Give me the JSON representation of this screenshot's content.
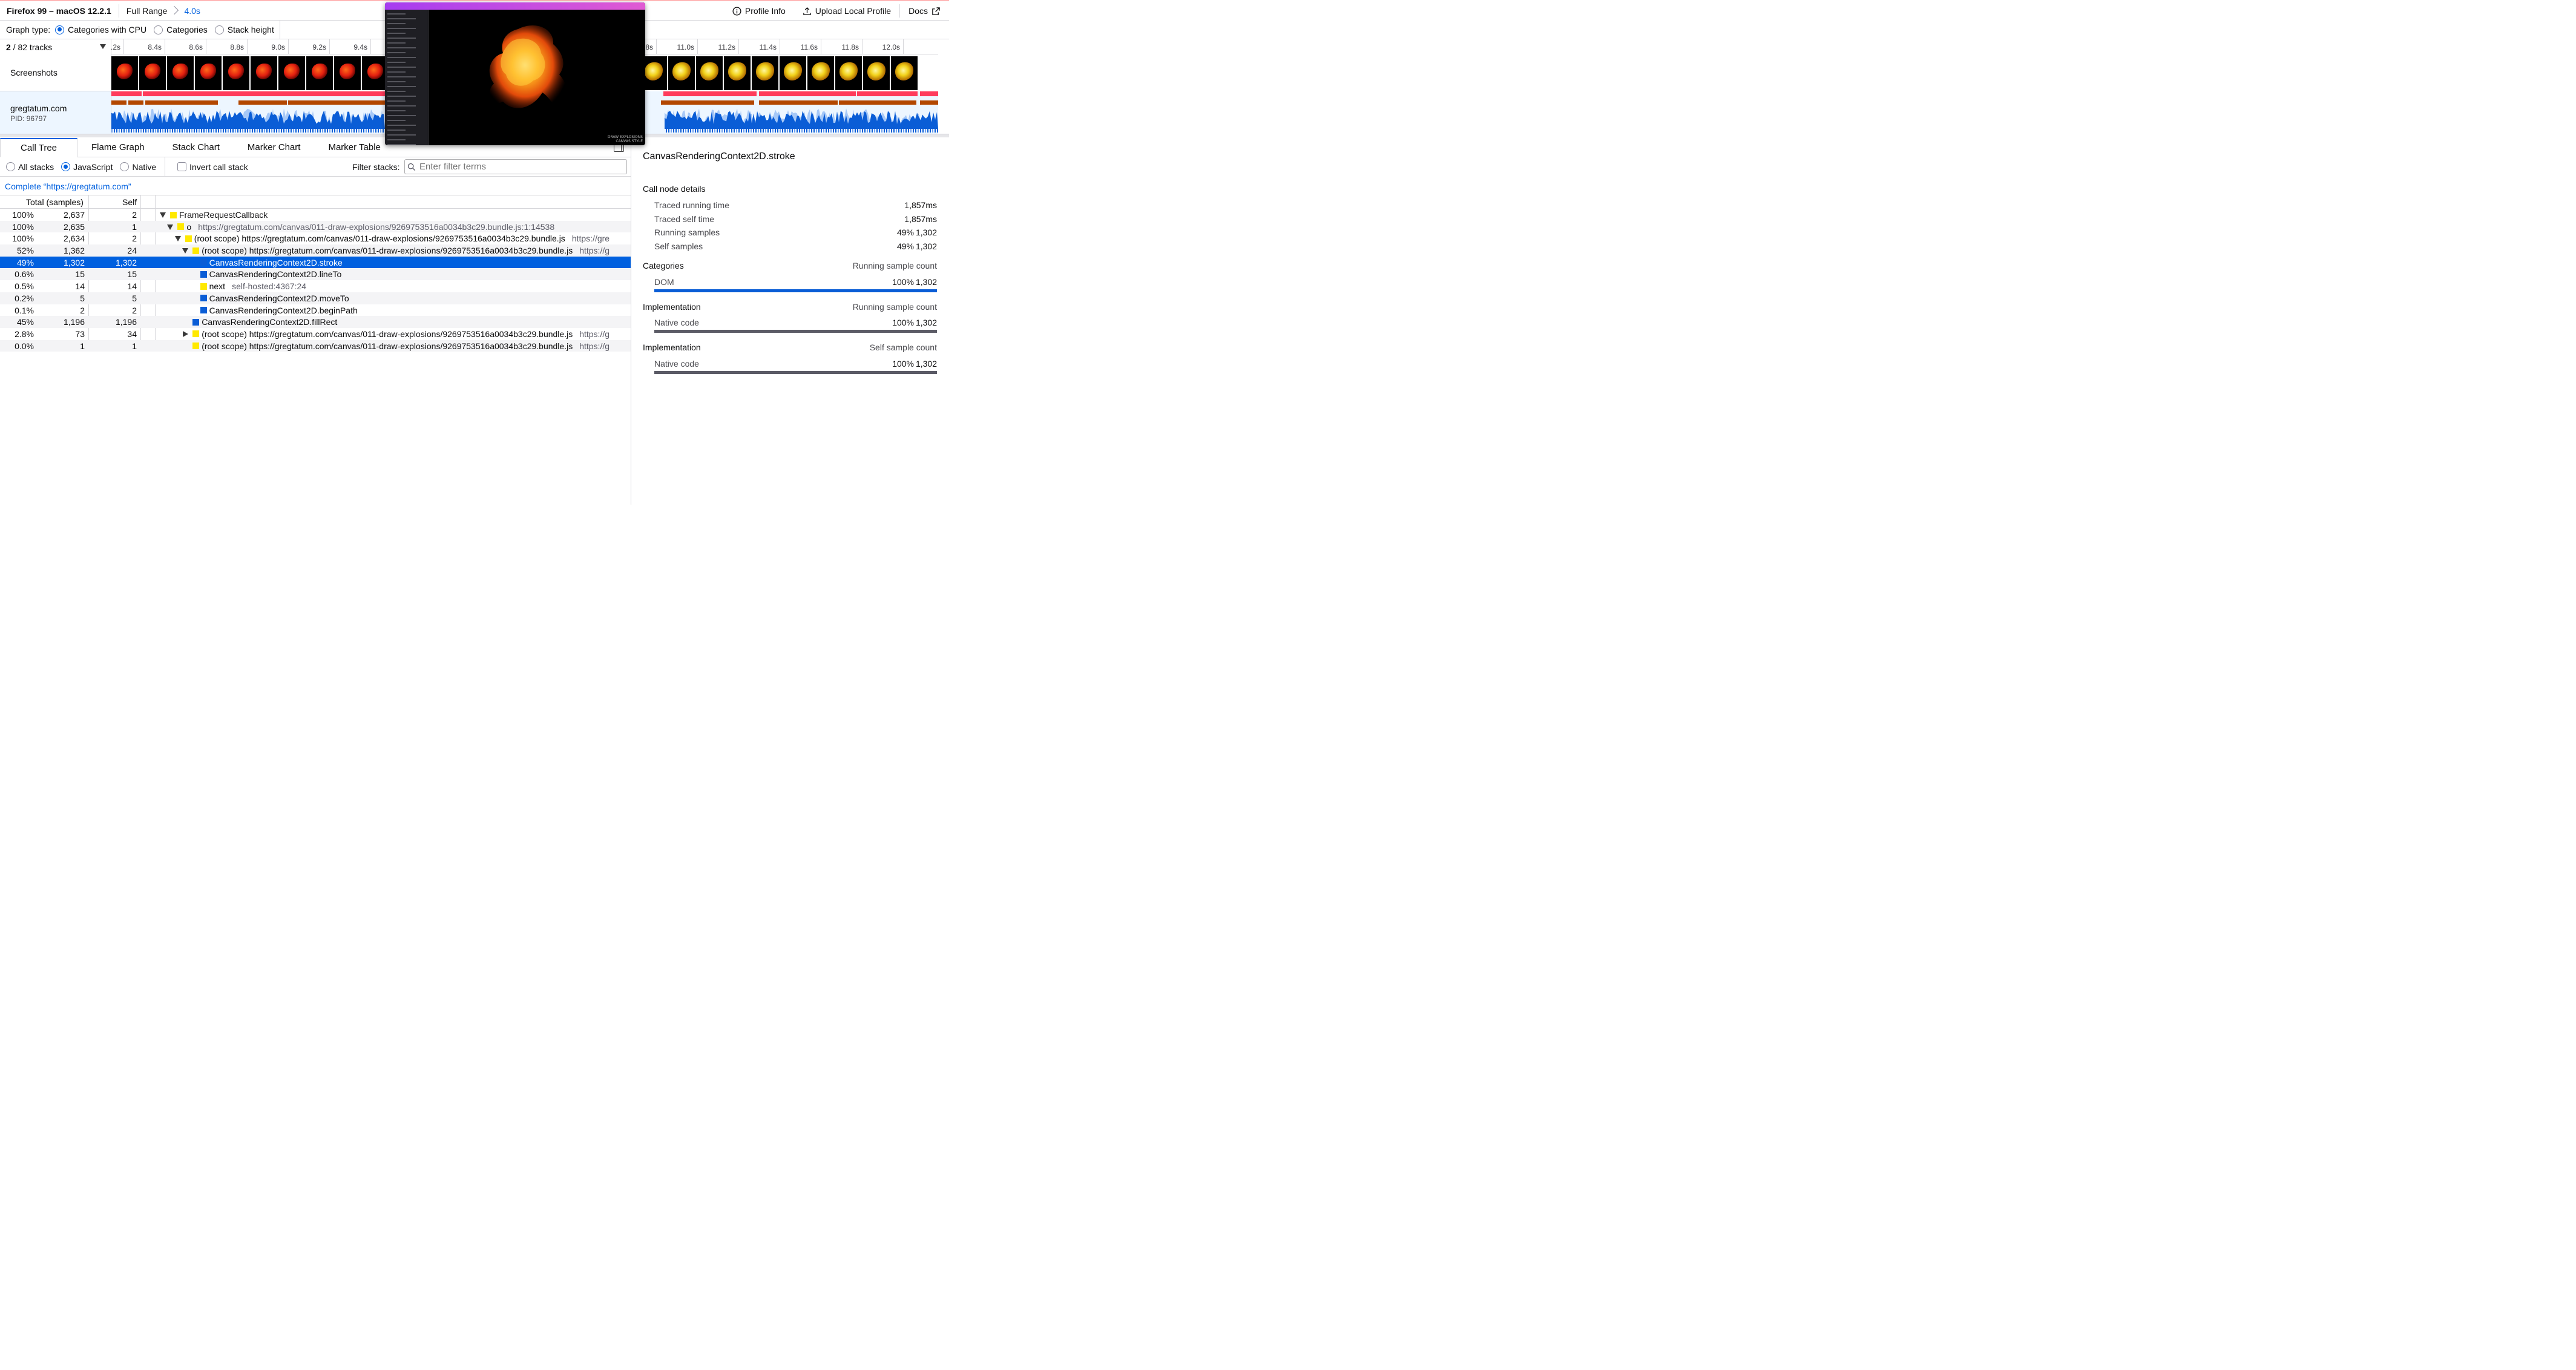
{
  "topbar": {
    "title": "Firefox 99 – macOS 12.2.1",
    "breadcrumb_root": "Full Range",
    "breadcrumb_selection": "4.0s",
    "profile_info": "Profile Info",
    "upload": "Upload Local Profile",
    "docs": "Docs"
  },
  "graph_type": {
    "label": "Graph type:",
    "options": [
      "Categories with CPU",
      "Categories",
      "Stack height"
    ],
    "selected": "Categories with CPU"
  },
  "tracks": {
    "count_current": "2",
    "count_text": " / 82 tracks",
    "ruler_labels": [
      ".2s",
      "8.4s",
      "8.6s",
      "8.8s",
      "9.0s",
      "9.2s",
      "9.4s",
      ".8s",
      "11.0s",
      "11.2s",
      "11.4s",
      "11.6s",
      "11.8s",
      "12.0s"
    ],
    "screenshots_label": "Screenshots",
    "process_name": "gregtatum.com",
    "process_pid": "PID: 96797"
  },
  "popup": {
    "caption_line1": "DRAW EXPLOSIONS",
    "caption_line2": "CANVAS STYLE"
  },
  "tabs": [
    "Call Tree",
    "Flame Graph",
    "Stack Chart",
    "Marker Chart",
    "Marker Table"
  ],
  "filter": {
    "all_stacks": "All stacks",
    "javascript": "JavaScript",
    "native": "Native",
    "invert": "Invert call stack",
    "filter_label": "Filter stacks:",
    "placeholder": "Enter filter terms"
  },
  "breadcrumb": "Complete “https://gregtatum.com”",
  "table": {
    "header_total": "Total (samples)",
    "header_self": "Self",
    "rows": [
      {
        "pct": "100%",
        "total": "2,637",
        "self": "2",
        "depth": 0,
        "twisty": "down",
        "cat": "js",
        "name": "FrameRequestCallback",
        "origin": ""
      },
      {
        "pct": "100%",
        "total": "2,635",
        "self": "1",
        "depth": 1,
        "twisty": "down",
        "cat": "js",
        "name": "o",
        "origin": "https://gregtatum.com/canvas/011-draw-explosions/9269753516a0034b3c29.bundle.js:1:14538"
      },
      {
        "pct": "100%",
        "total": "2,634",
        "self": "2",
        "depth": 2,
        "twisty": "down",
        "cat": "js",
        "name": "(root scope) https://gregtatum.com/canvas/011-draw-explosions/9269753516a0034b3c29.bundle.js",
        "origin": "https://gre"
      },
      {
        "pct": "52%",
        "total": "1,362",
        "self": "24",
        "depth": 3,
        "twisty": "down",
        "cat": "js",
        "name": "(root scope) https://gregtatum.com/canvas/011-draw-explosions/9269753516a0034b3c29.bundle.js",
        "origin": "https://g"
      },
      {
        "pct": "49%",
        "total": "1,302",
        "self": "1,302",
        "depth": 4,
        "twisty": "none",
        "cat": "dom",
        "name": "CanvasRenderingContext2D.stroke",
        "origin": "",
        "selected": true
      },
      {
        "pct": "0.6%",
        "total": "15",
        "self": "15",
        "depth": 4,
        "twisty": "none",
        "cat": "dom",
        "name": "CanvasRenderingContext2D.lineTo",
        "origin": ""
      },
      {
        "pct": "0.5%",
        "total": "14",
        "self": "14",
        "depth": 4,
        "twisty": "none",
        "cat": "js",
        "name": "next",
        "origin": "self-hosted:4367:24"
      },
      {
        "pct": "0.2%",
        "total": "5",
        "self": "5",
        "depth": 4,
        "twisty": "none",
        "cat": "dom",
        "name": "CanvasRenderingContext2D.moveTo",
        "origin": ""
      },
      {
        "pct": "0.1%",
        "total": "2",
        "self": "2",
        "depth": 4,
        "twisty": "none",
        "cat": "dom",
        "name": "CanvasRenderingContext2D.beginPath",
        "origin": ""
      },
      {
        "pct": "45%",
        "total": "1,196",
        "self": "1,196",
        "depth": 3,
        "twisty": "none",
        "cat": "dom",
        "name": "CanvasRenderingContext2D.fillRect",
        "origin": ""
      },
      {
        "pct": "2.8%",
        "total": "73",
        "self": "34",
        "depth": 3,
        "twisty": "right",
        "cat": "js",
        "name": "(root scope) https://gregtatum.com/canvas/011-draw-explosions/9269753516a0034b3c29.bundle.js",
        "origin": "https://g"
      },
      {
        "pct": "0.0%",
        "total": "1",
        "self": "1",
        "depth": 3,
        "twisty": "none",
        "cat": "js",
        "name": "(root scope) https://gregtatum.com/canvas/011-draw-explosions/9269753516a0034b3c29.bundle.js",
        "origin": "https://g"
      }
    ]
  },
  "sidebar": {
    "title": "CanvasRenderingContext2D.stroke",
    "details_heading": "Call node details",
    "traced_running_label": "Traced running time",
    "traced_running_value": "1,857ms",
    "traced_self_label": "Traced self time",
    "traced_self_value": "1,857ms",
    "running_samples_label": "Running samples",
    "running_samples_pct": "49%",
    "running_samples_value": "1,302",
    "self_samples_label": "Self samples",
    "self_samples_pct": "49%",
    "self_samples_value": "1,302",
    "categories_heading": "Categories",
    "categories_col": "Running sample count",
    "dom_label": "DOM",
    "dom_pct": "100%",
    "dom_value": "1,302",
    "dom_fraction": 1.0,
    "impl1_heading": "Implementation",
    "impl1_col": "Running sample count",
    "impl1_label": "Native code",
    "impl1_pct": "100%",
    "impl1_value": "1,302",
    "impl1_fraction": 1.0,
    "impl2_heading": "Implementation",
    "impl2_col": "Self sample count",
    "impl2_label": "Native code",
    "impl2_pct": "100%",
    "impl2_value": "1,302",
    "impl2_fraction": 1.0
  },
  "colors": {
    "accent": "#0060df",
    "js_category": "#ffe900",
    "dom_category": "#0a5dd6",
    "activity_red": "#ff3b5c",
    "activity_brown": "#b34700"
  }
}
